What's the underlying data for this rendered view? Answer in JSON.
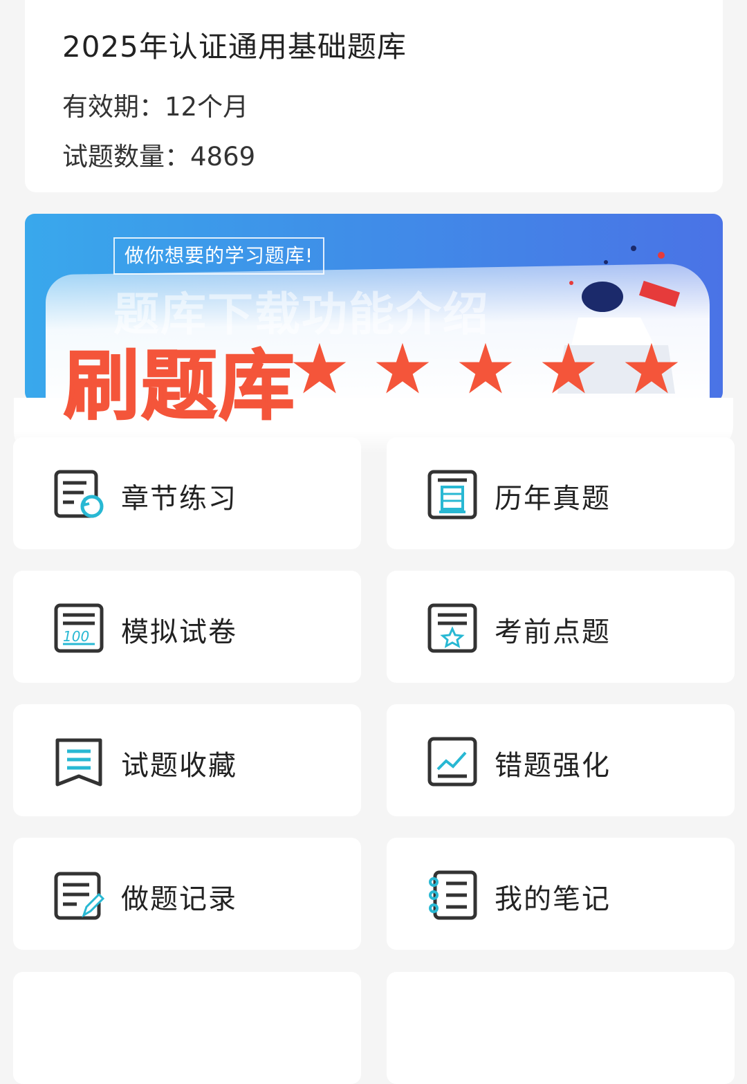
{
  "info": {
    "title": "2025年认证通用基础题库",
    "validity": "有效期：12个月",
    "question_count": "试题数量：4869"
  },
  "banner": {
    "tagline": "做你想要的学习题库!",
    "ghost_title": "题库下载功能介绍",
    "overlay_title": "刷题库",
    "stars": [
      "★",
      "★",
      "★",
      "★",
      "★"
    ],
    "accent": "#f4553a"
  },
  "menu": [
    {
      "label": "章节练习",
      "icon": "chapter-practice-icon"
    },
    {
      "label": "历年真题",
      "icon": "past-exam-icon"
    },
    {
      "label": "模拟试卷",
      "icon": "mock-exam-icon"
    },
    {
      "label": "考前点题",
      "icon": "key-points-icon"
    },
    {
      "label": "试题收藏",
      "icon": "bookmark-icon"
    },
    {
      "label": "错题强化",
      "icon": "wrong-questions-icon"
    },
    {
      "label": "做题记录",
      "icon": "practice-record-icon"
    },
    {
      "label": "我的笔记",
      "icon": "notebook-icon"
    }
  ]
}
